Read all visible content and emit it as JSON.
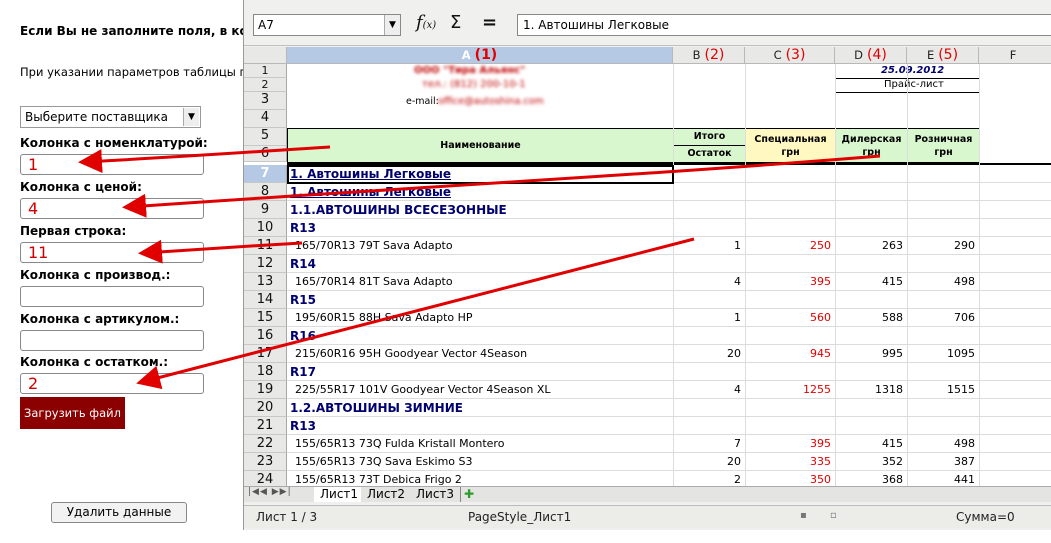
{
  "form": {
    "intro_bold": "Если Вы не заполните поля, в кот",
    "intro_text": "При указании параметров таблицы пр",
    "supplier_select": "Выберите поставщика",
    "fields": [
      {
        "label": "Колонка с номенклатурой:",
        "value": "1"
      },
      {
        "label": "Колонка с ценой:",
        "value": "4"
      },
      {
        "label": "Первая строка:",
        "value": "11"
      },
      {
        "label": "Колонка с производ.:",
        "value": ""
      },
      {
        "label": "Колонка с артикулом.:",
        "value": ""
      },
      {
        "label": "Колонка с остатком.:",
        "value": "2"
      }
    ],
    "upload_button": "Загрузить файл",
    "delete_button": "Удалить данные"
  },
  "calc": {
    "name_box": "A7",
    "formula_value": "1. Автошины Легковые",
    "columns": [
      {
        "letter": "A",
        "num": "(1)"
      },
      {
        "letter": "B",
        "num": "(2)"
      },
      {
        "letter": "C",
        "num": "(3)"
      },
      {
        "letter": "D",
        "num": "(4)"
      },
      {
        "letter": "E",
        "num": "(5)"
      },
      {
        "letter": "F",
        "num": ""
      }
    ],
    "header": {
      "company": "ООО \"Тира Альянс\"",
      "phone": "тел.: (812) 200-10-1",
      "email_label": "e-mail:",
      "email": "office@autoshina.com",
      "date": "25.09.2012",
      "price_list": "Прайс-лист",
      "name_col": "Наименование",
      "total": "Итого",
      "remain": "Остаток",
      "special": "Специальная грн",
      "dealer": "Дилерская грн",
      "retail": "Розничная грн"
    },
    "rows": [
      {
        "n": "7",
        "a": "1. Автошины Легковые",
        "type": "title"
      },
      {
        "n": "8",
        "a": "1. Автошины Легковые",
        "type": "title"
      },
      {
        "n": "9",
        "a": "1.1.АВТОШИНЫ ВСЕСЕЗОННЫЕ",
        "type": "group"
      },
      {
        "n": "10",
        "a": "R13",
        "type": "group"
      },
      {
        "n": "11",
        "a": "165/70R13 79T Sava Adapto",
        "b": "1",
        "c": "250",
        "d": "263",
        "e": "290"
      },
      {
        "n": "12",
        "a": "R14",
        "type": "group"
      },
      {
        "n": "13",
        "a": "165/70R14 81T Sava Adapto",
        "b": "4",
        "c": "395",
        "d": "415",
        "e": "498"
      },
      {
        "n": "14",
        "a": "R15",
        "type": "group"
      },
      {
        "n": "15",
        "a": "195/60R15 88H Sava Adapto HP",
        "b": "1",
        "c": "560",
        "d": "588",
        "e": "706"
      },
      {
        "n": "16",
        "a": "R16",
        "type": "group"
      },
      {
        "n": "17",
        "a": "215/60R16 95H Goodyear Vector 4Season",
        "b": "20",
        "c": "945",
        "d": "995",
        "e": "1095"
      },
      {
        "n": "18",
        "a": "R17",
        "type": "group"
      },
      {
        "n": "19",
        "a": "225/55R17 101V Goodyear Vector 4Season XL",
        "b": "4",
        "c": "1255",
        "d": "1318",
        "e": "1515"
      },
      {
        "n": "20",
        "a": "1.2.АВТОШИНЫ ЗИМНИЕ",
        "type": "group"
      },
      {
        "n": "21",
        "a": "R13",
        "type": "group"
      },
      {
        "n": "22",
        "a": "155/65R13 73Q Fulda Kristall Montero",
        "b": "7",
        "c": "395",
        "d": "415",
        "e": "498"
      },
      {
        "n": "23",
        "a": "155/65R13 73Q Sava Eskimo S3",
        "b": "20",
        "c": "335",
        "d": "352",
        "e": "387"
      },
      {
        "n": "24",
        "a": "155/65R13 73T Debica Frigo 2",
        "b": "2",
        "c": "350",
        "d": "368",
        "e": "441"
      }
    ],
    "sheets": [
      "Лист1",
      "Лист2",
      "Лист3"
    ],
    "status": {
      "sheet": "Лист 1 / 3",
      "style": "PageStyle_Лист1",
      "sum": "Сумма=0"
    }
  },
  "colors": {
    "accent_red": "#e00000",
    "upload_bg": "#8b0000",
    "header_green": "#d9f7cf",
    "special_yellow": "#fff8c0"
  }
}
